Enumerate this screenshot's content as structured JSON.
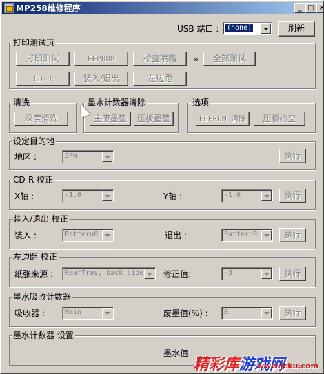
{
  "window": {
    "title": "MP258维修程序",
    "minimize": "_",
    "maximize": "□",
    "close": "×"
  },
  "usb": {
    "label": "USB 端口 :",
    "selected": "(none)",
    "refresh": "刷新"
  },
  "print_test": {
    "title": "打印测试页",
    "buttons": [
      "打印测试",
      "EEPROM",
      "检查喷嘴",
      "全部测试",
      "CD-R",
      "装入/退出",
      "左边距"
    ],
    "separator": "»"
  },
  "cleaning": {
    "title": "清洗",
    "deep_clean": "深度清洗"
  },
  "ink_counter_reset": {
    "title": "墨水计数器清除",
    "main_pad": "主废墨垫",
    "platen_pad": "压板墨垫"
  },
  "options": {
    "title": "选项",
    "eeprom_clear": "EEPROM 清除",
    "platen_check": "压板检查"
  },
  "destination": {
    "title": "设定目的地",
    "region_label": "地区 :",
    "region_value": "JPN",
    "execute": "执行"
  },
  "cdr": {
    "title": "CD-R 校正",
    "x_label": "X轴 :",
    "x_value": "-1.0",
    "y_label": "Y轴 :",
    "y_value": "-1.0",
    "execute": "执行"
  },
  "load_eject": {
    "title": "装入/退出 校正",
    "load_label": "装入 :",
    "load_value": "Pattern0",
    "eject_label": "退出 :",
    "eject_value": "Pattern0",
    "execute": "执行"
  },
  "left_margin": {
    "title": "左边距 校正",
    "source_label": "纸张来源 :",
    "source_value": "RearTray, back side",
    "correction_label": "修正值:",
    "correction_value": "-3",
    "execute": "执行"
  },
  "absorber": {
    "title": "墨水吸收计数器",
    "absorber_label": "吸收器 :",
    "absorber_value": "Main",
    "waste_label": "废墨值(%) :",
    "waste_value": "0",
    "execute": "执行"
  },
  "ink_counter_set": {
    "title": "墨水计数器 设置",
    "ink_label": "墨水值"
  },
  "watermark": {
    "brand_a": "精彩库",
    "brand_b": "游戏网",
    "url": "www.jcku.com"
  }
}
